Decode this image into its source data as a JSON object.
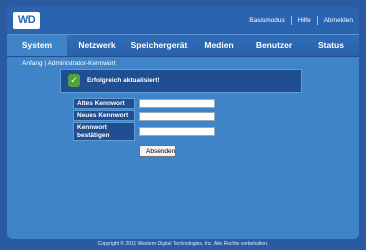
{
  "header": {
    "logo_text": "WD",
    "links": [
      "Basismodus",
      "Hilfe",
      "Abmelden"
    ]
  },
  "nav": {
    "tabs": [
      "System",
      "Netzwerk",
      "Speichergerät",
      "Medien",
      "Benutzer",
      "Status"
    ],
    "active_tab": "System"
  },
  "breadcrumb": {
    "home": "Anfang",
    "separator": "|",
    "current": "Administrator-Kennwort"
  },
  "status": {
    "message": "Erfolgreich aktualisiert!",
    "icon": "check-icon"
  },
  "form": {
    "old_password_label": "Altes Kennwort",
    "new_password_label": "Neues Kennwort",
    "confirm_password_label_line1": "Kennwort",
    "confirm_password_label_line2": "bestätigen",
    "old_password_value": "",
    "new_password_value": "",
    "confirm_password_value": "",
    "submit_label": "Absenden"
  },
  "footer": {
    "copyright": "Copyright © 2011 Western Digital Technologies, Inc. Alle Rechte vorbehalten."
  },
  "colors": {
    "background": "#2a5ba2",
    "content": "#3f83c9",
    "header": "#2a64b0",
    "panel": "#1f4e91",
    "success": "#4ea23a"
  }
}
